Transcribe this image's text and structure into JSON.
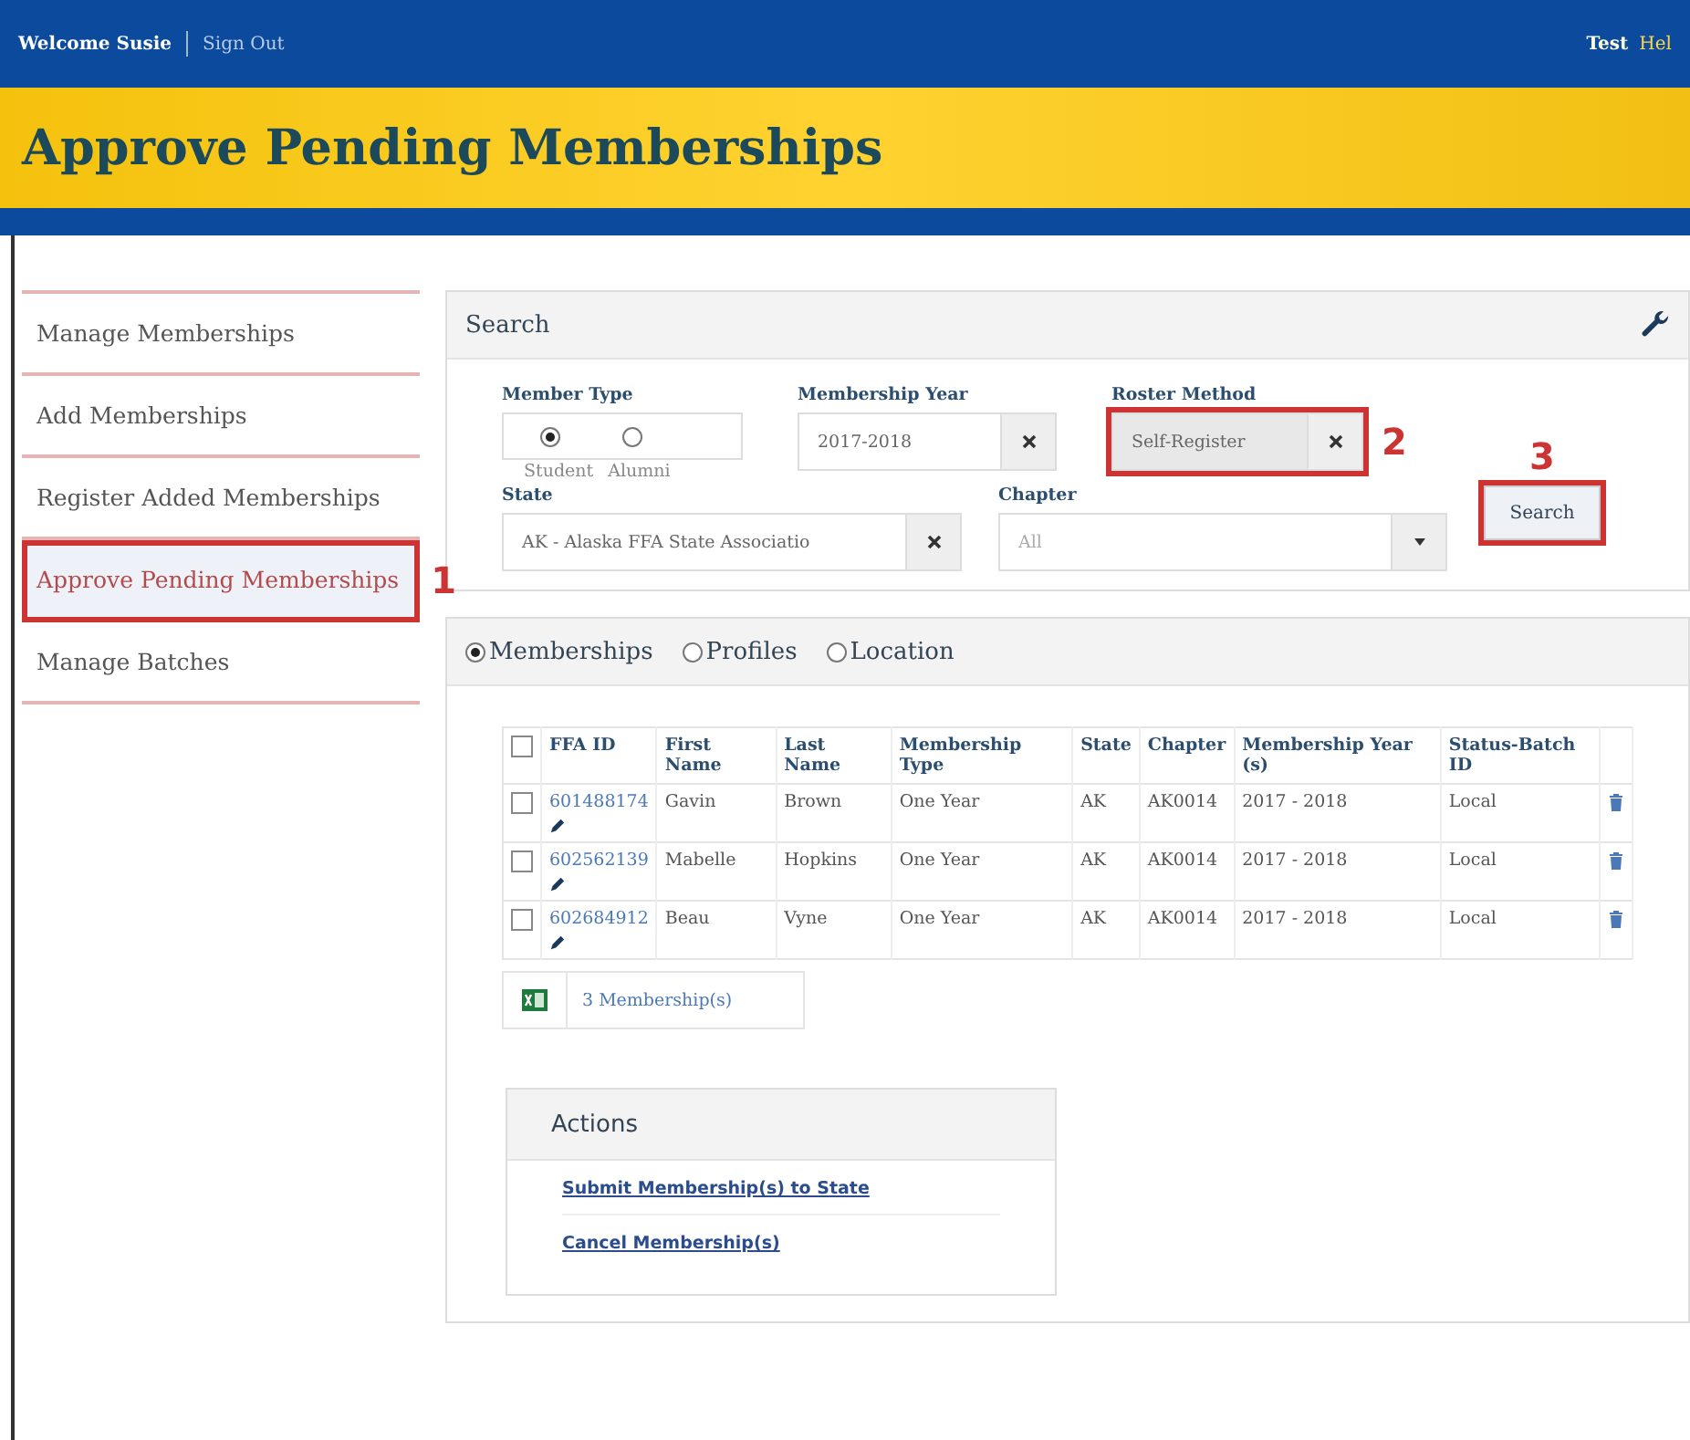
{
  "top_bar": {
    "welcome": "Welcome Susie",
    "sign_out": "Sign Out",
    "right_links": [
      "Test",
      "Hel"
    ]
  },
  "page_title": "Approve Pending Memberships",
  "sidebar": {
    "items": [
      {
        "label": "Manage Memberships",
        "selected": false
      },
      {
        "label": "Add Memberships",
        "selected": false
      },
      {
        "label": "Register Added Memberships",
        "selected": false
      },
      {
        "label": "Approve Pending Memberships",
        "selected": true,
        "callout": "1"
      },
      {
        "label": "Manage Batches",
        "selected": false
      }
    ]
  },
  "search": {
    "title": "Search",
    "member_type": {
      "label": "Member Type",
      "options": [
        {
          "label": "Student",
          "selected": true
        },
        {
          "label": "Alumni",
          "selected": false
        }
      ]
    },
    "membership_year": {
      "label": "Membership Year",
      "value": "2017-2018"
    },
    "roster_method": {
      "label": "Roster Method",
      "value": "Self-Register",
      "callout": "2"
    },
    "state": {
      "label": "State",
      "value": "AK - Alaska FFA State Associatio"
    },
    "chapter": {
      "label": "Chapter",
      "placeholder": "All"
    },
    "search_button": {
      "label": "Search",
      "callout": "3"
    }
  },
  "results": {
    "views": [
      {
        "label": "Memberships",
        "selected": true
      },
      {
        "label": "Profiles",
        "selected": false
      },
      {
        "label": "Location",
        "selected": false
      }
    ],
    "table": {
      "columns": [
        "FFA ID",
        "First Name",
        "Last Name",
        "Membership Type",
        "State",
        "Chapter",
        "Membership Year (s)",
        "Status-Batch ID"
      ],
      "all_checked": false,
      "rows": [
        {
          "checked": false,
          "cells": [
            "601488174",
            "Gavin",
            "Brown",
            "One Year",
            "AK",
            "AK0014",
            "2017 - 2018",
            "Local"
          ]
        },
        {
          "checked": false,
          "cells": [
            "602562139",
            "Mabelle",
            "Hopkins",
            "One Year",
            "AK",
            "AK0014",
            "2017 - 2018",
            "Local"
          ]
        },
        {
          "checked": false,
          "cells": [
            "602684912",
            "Beau",
            "Vyne",
            "One Year",
            "AK",
            "AK0014",
            "2017 - 2018",
            "Local"
          ]
        }
      ]
    },
    "count": "3 Membership(s)"
  },
  "actions": {
    "title": "Actions",
    "links": [
      "Submit Membership(s) to State",
      "Cancel Membership(s)"
    ]
  }
}
